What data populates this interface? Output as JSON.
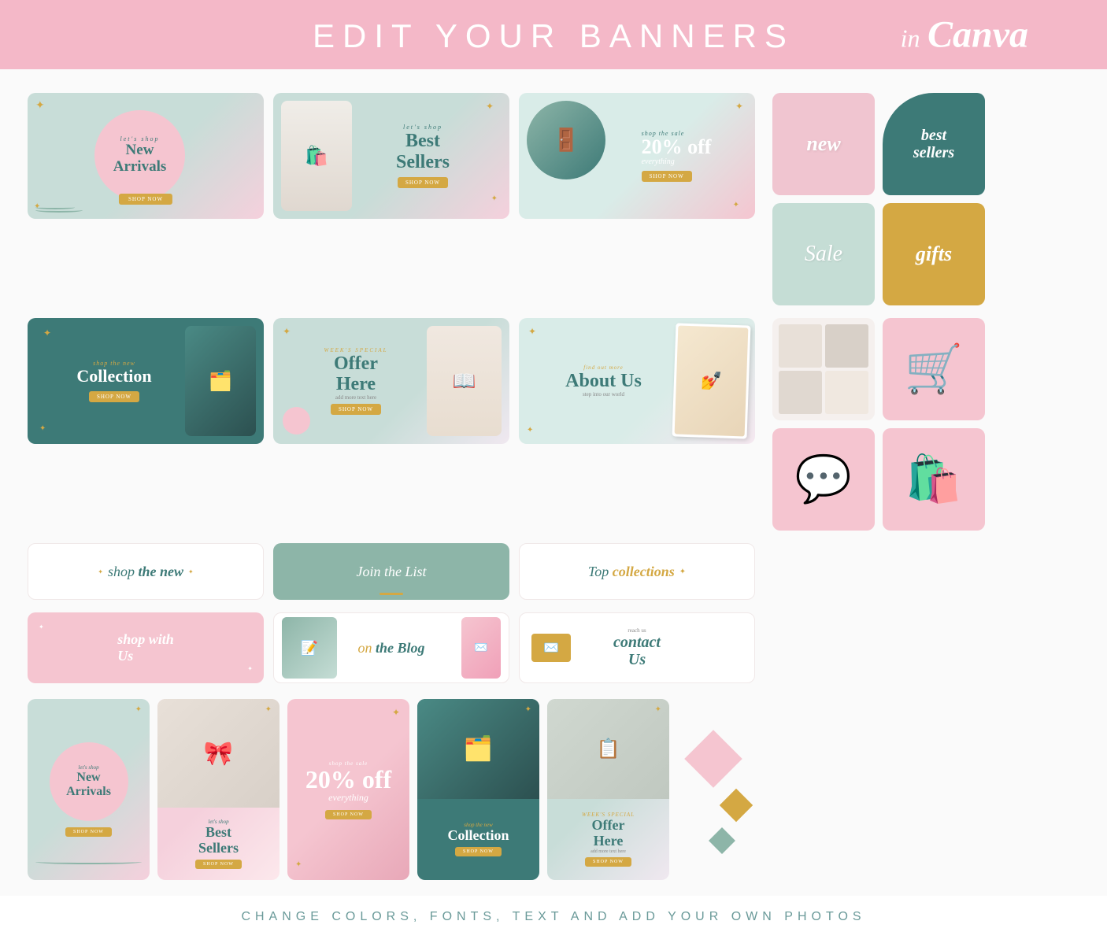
{
  "header": {
    "title": "EDIT YOUR BANNERS",
    "subtitle_in": "in",
    "subtitle_canva": "Canva"
  },
  "footer": {
    "text": "CHANGE COLORS, FONTS, TEXT AND ADD YOUR OWN PHOTOS"
  },
  "banners": {
    "row1": [
      {
        "id": "new-arrivals",
        "small": "let's shop",
        "big": "New Arrivals",
        "btn": "SHOP NOW",
        "bg": "mint-pink"
      },
      {
        "id": "best-sellers",
        "small": "let's shop",
        "big": "Best Sellers",
        "btn": "SHOP NOW",
        "bg": "mint-pink"
      },
      {
        "id": "20-off",
        "small": "shop the sale",
        "big": "20% off",
        "sub": "everything",
        "btn": "SHOP NOW",
        "bg": "mint-pink"
      }
    ],
    "row1_right": [
      {
        "id": "new-sq",
        "text": "new",
        "bg": "pink"
      },
      {
        "id": "best-sellers-sq",
        "text": "best sellers",
        "bg": "teal"
      }
    ],
    "row2": [
      {
        "id": "collection",
        "small": "shop the new",
        "big": "Collection",
        "btn": "SHOP NOW",
        "bg": "teal"
      },
      {
        "id": "offer-here",
        "small": "week's special",
        "big": "Offer Here",
        "sub": "add more text here",
        "btn": "SHOP NOW",
        "bg": "mint"
      },
      {
        "id": "about-us",
        "small": "find out more",
        "big": "About Us",
        "sub": "step into our world",
        "bg": "mint-photo"
      }
    ],
    "row2_right": [
      {
        "id": "sale-sq",
        "text": "Sale",
        "bg": "mint"
      },
      {
        "id": "gifts-sq",
        "text": "gifts",
        "bg": "yellow"
      }
    ],
    "row3": [
      {
        "id": "shop-the-new-thin",
        "text": "shop the new",
        "bg": "white"
      },
      {
        "id": "join-list-thin",
        "text": "Join the List",
        "bg": "sage"
      },
      {
        "id": "top-collections-thin",
        "text": "Top collections",
        "bg": "white"
      }
    ],
    "row3_right": [
      {
        "id": "photo-sq",
        "bg": "photo"
      },
      {
        "id": "cart-sq",
        "bg": "pink",
        "icon": "cart"
      }
    ],
    "row4": [
      {
        "id": "shop-with-us",
        "text": "shop with Us",
        "bg": "pink"
      },
      {
        "id": "on-the-blog",
        "text": "on the Blog",
        "bg": "white-photo"
      },
      {
        "id": "contact-us",
        "big": "contact Us",
        "bg": "white-envelope"
      }
    ],
    "row4_right": [
      {
        "id": "chat-sq",
        "bg": "pink",
        "icon": "chat"
      },
      {
        "id": "bag-sq",
        "bg": "pink",
        "icon": "bag"
      }
    ],
    "portrait_row": [
      {
        "id": "p-new-arrivals",
        "small": "let's shop",
        "big": "New Arrivals",
        "btn": "SHOP NOW",
        "bg": "mint-pink"
      },
      {
        "id": "p-best-sellers",
        "small": "let's shop",
        "big": "Best Sellers",
        "btn": "SHOP NOW",
        "bg": "pink-light"
      },
      {
        "id": "p-20-off",
        "small": "shop the sale",
        "big": "20% off",
        "sub": "everything",
        "btn": "SHOP NOW",
        "bg": "pink-dark"
      },
      {
        "id": "p-collection",
        "small": "shop the new",
        "big": "Collection",
        "btn": "SHOP NOW",
        "bg": "teal-dark"
      },
      {
        "id": "p-offer",
        "small": "week's special",
        "big": "Offer Here",
        "sub": "add more text here",
        "btn": "SHOP NOW",
        "bg": "mint-check"
      }
    ]
  }
}
